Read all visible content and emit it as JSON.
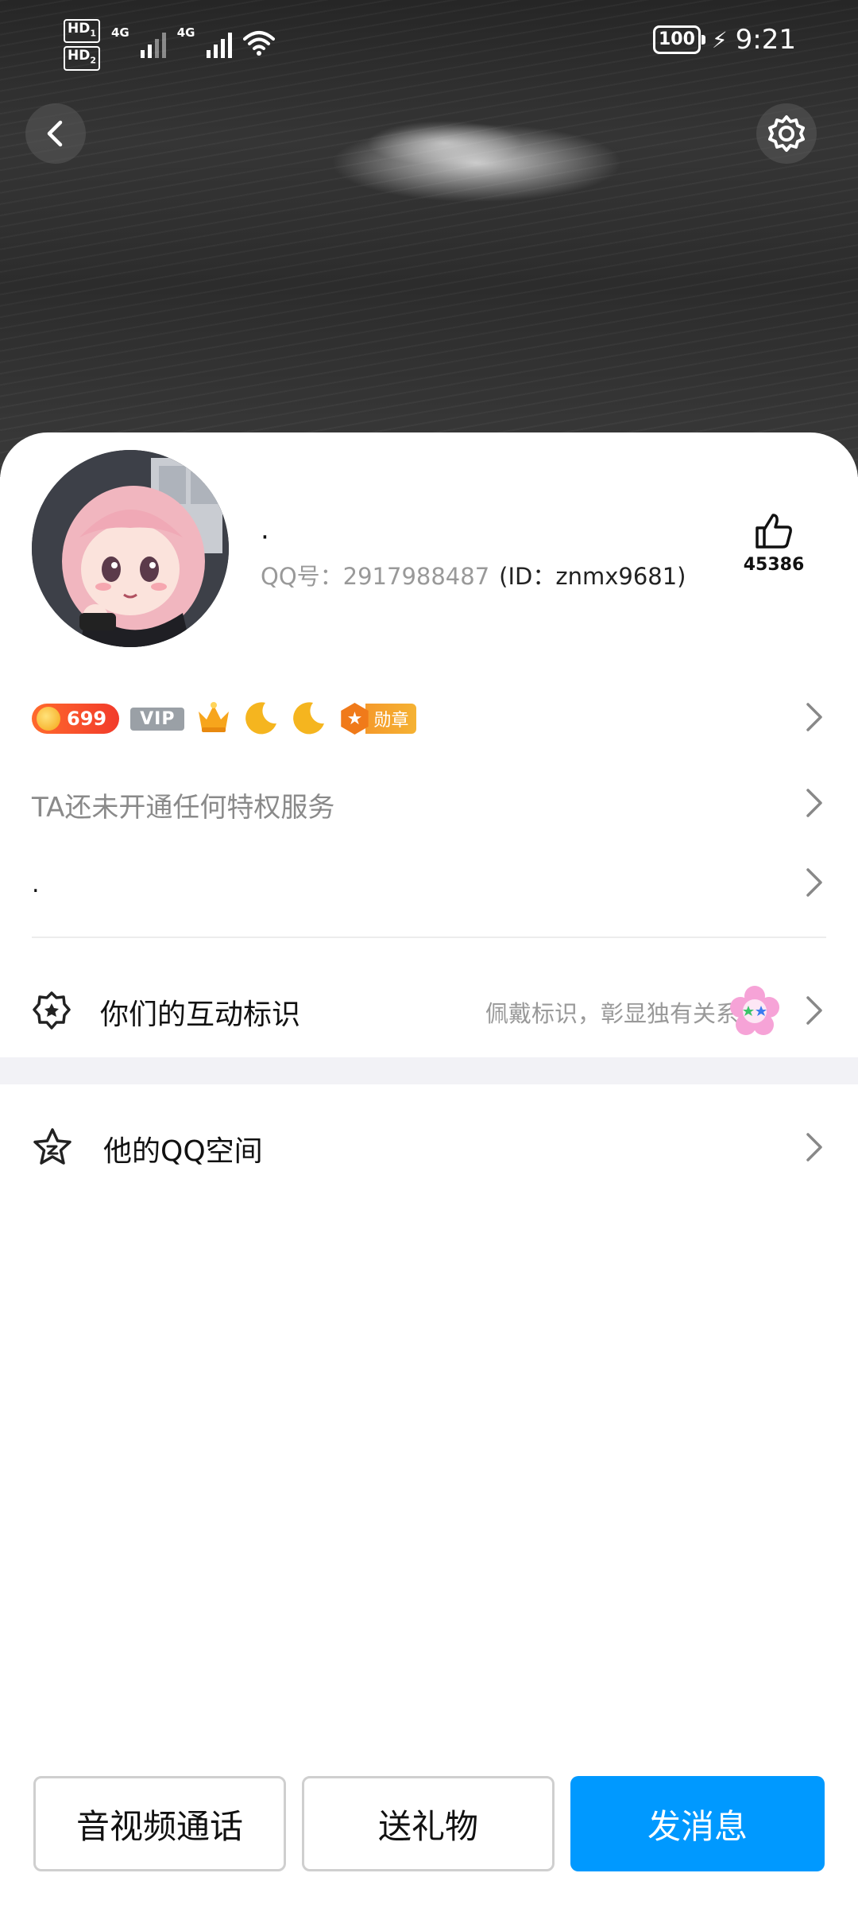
{
  "status_bar": {
    "hd1": "HD",
    "hd1_sub": "1",
    "hd2": "HD",
    "hd2_sub": "2",
    "network1": "4G",
    "network2": "4G",
    "battery": "100",
    "time": "9:21"
  },
  "header": {
    "back_icon": "chevron-left-icon",
    "settings_icon": "gear-icon"
  },
  "profile": {
    "nickname": "·",
    "qq_label": "QQ号：2917988487",
    "id_label": "(ID：znmx9681)",
    "like_count": "45386",
    "like_icon": "thumbs-up-icon"
  },
  "badges": {
    "level": "699",
    "vip": "VIP",
    "medal_label": "勋章"
  },
  "rows": {
    "privilege": "TA还未开通任何特权服务",
    "signature": ".",
    "interaction_title": "你们的互动标识",
    "interaction_hint": "佩戴标识，彰显独有关系",
    "qzone": "他的QQ空间"
  },
  "actions": {
    "call": "音视频通话",
    "gift": "送礼物",
    "message": "发消息"
  },
  "colors": {
    "primary": "#0099ff",
    "coin": "#f23b2b",
    "medal": "#f07a1a"
  }
}
